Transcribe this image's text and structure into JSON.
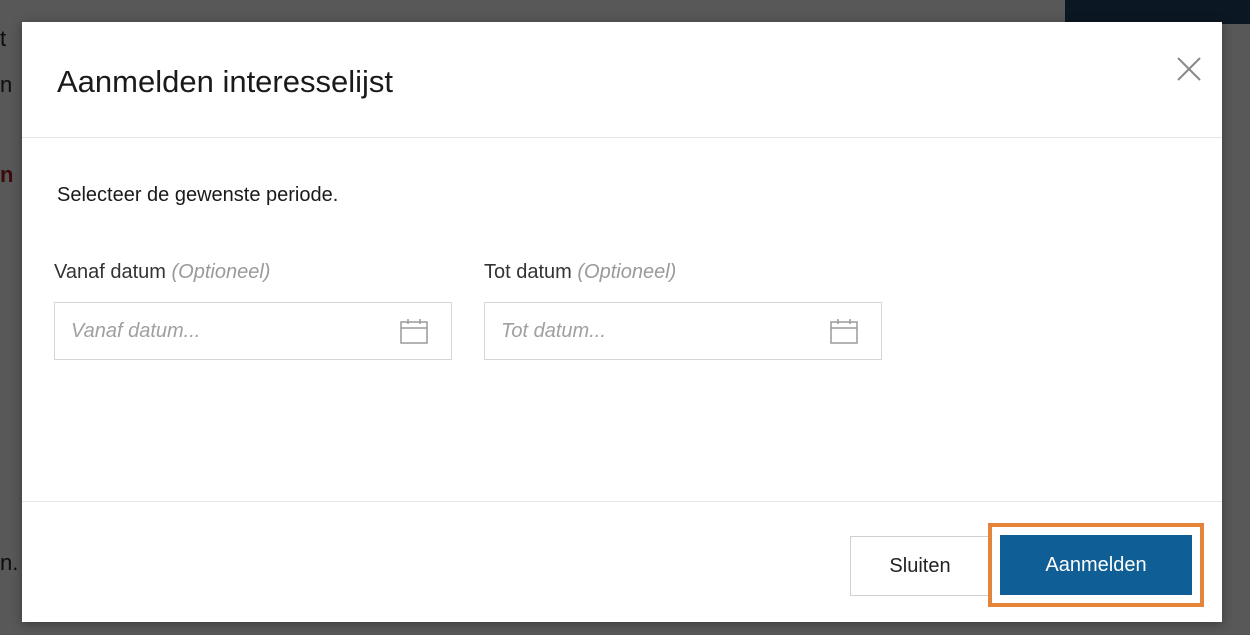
{
  "modal": {
    "title": "Aanmelden interesselijst",
    "intro": "Selecteer de gewenste periode.",
    "from": {
      "label": "Vanaf datum",
      "optional": "(Optioneel)",
      "placeholder": "Vanaf datum..."
    },
    "to": {
      "label": "Tot datum",
      "optional": "(Optioneel)",
      "placeholder": "Tot datum..."
    },
    "buttons": {
      "close": "Sluiten",
      "submit": "Aanmelden"
    }
  },
  "icons": {
    "close": "close-icon",
    "calendar": "calendar-icon"
  },
  "colors": {
    "primary": "#0f5f96",
    "highlight": "#e3843a",
    "overlay": "#000000"
  }
}
